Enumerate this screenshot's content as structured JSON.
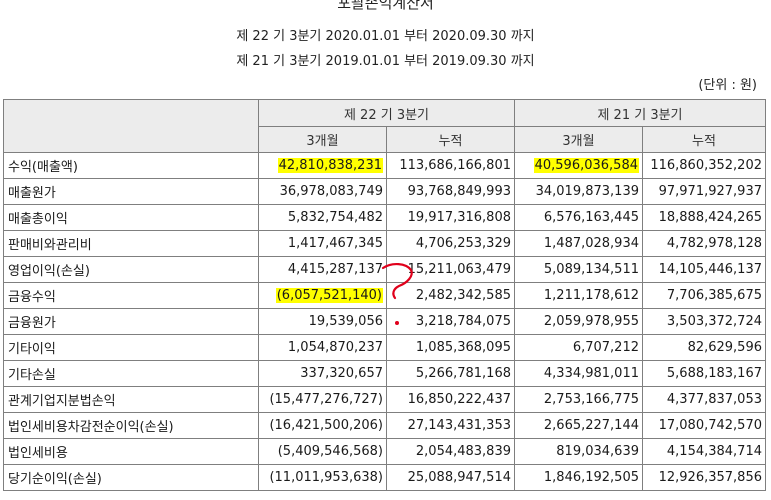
{
  "statement": {
    "title": "포괄손익계산서",
    "period_current": "제 22 기 3분기 2020.01.01 부터 2020.09.30 까지",
    "period_prior": "제 21 기 3분기 2019.01.01 부터 2019.09.30 까지",
    "unit": "(단위 : 원)"
  },
  "table": {
    "header": {
      "current_period": "제 22 기 3분기",
      "prior_period": "제 21 기 3분기",
      "three_month": "3개월",
      "cumulative": "누적"
    },
    "rows": [
      {
        "label": "수익(매출액)",
        "values": [
          "42,810,838,231",
          "113,686,166,801",
          "40,596,036,584",
          "116,860,352,202"
        ],
        "highlight": [
          true,
          false,
          true,
          false
        ]
      },
      {
        "label": "매출원가",
        "values": [
          "36,978,083,749",
          "93,768,849,993",
          "34,019,873,139",
          "97,971,927,937"
        ],
        "highlight": [
          false,
          false,
          false,
          false
        ]
      },
      {
        "label": "매출총이익",
        "values": [
          "5,832,754,482",
          "19,917,316,808",
          "6,576,163,445",
          "18,888,424,265"
        ],
        "highlight": [
          false,
          false,
          false,
          false
        ]
      },
      {
        "label": "판매비와관리비",
        "values": [
          "1,417,467,345",
          "4,706,253,329",
          "1,487,028,934",
          "4,782,978,128"
        ],
        "highlight": [
          false,
          false,
          false,
          false
        ]
      },
      {
        "label": "영업이익(손실)",
        "values": [
          "4,415,287,137",
          "15,211,063,479",
          "5,089,134,511",
          "14,105,446,137"
        ],
        "highlight": [
          false,
          false,
          false,
          false
        ]
      },
      {
        "label": "금융수익",
        "values": [
          "(6,057,521,140)",
          "2,482,342,585",
          "1,211,178,612",
          "7,706,385,675"
        ],
        "highlight": [
          true,
          false,
          false,
          false
        ]
      },
      {
        "label": "금융원가",
        "values": [
          "19,539,056",
          "3,218,784,075",
          "2,059,978,955",
          "3,503,372,724"
        ],
        "highlight": [
          false,
          false,
          false,
          false
        ]
      },
      {
        "label": "기타이익",
        "values": [
          "1,054,870,237",
          "1,085,368,095",
          "6,707,212",
          "82,629,596"
        ],
        "highlight": [
          false,
          false,
          false,
          false
        ]
      },
      {
        "label": "기타손실",
        "values": [
          "337,320,657",
          "5,266,781,168",
          "4,334,981,011",
          "5,688,183,167"
        ],
        "highlight": [
          false,
          false,
          false,
          false
        ]
      },
      {
        "label": "관계기업지분법손익",
        "values": [
          "(15,477,276,727)",
          "16,850,222,437",
          "2,753,166,775",
          "4,377,837,053"
        ],
        "highlight": [
          false,
          false,
          false,
          false
        ]
      },
      {
        "label": "법인세비용차감전순이익(손실)",
        "values": [
          "(16,421,500,206)",
          "27,143,431,353",
          "2,665,227,144",
          "17,080,742,570"
        ],
        "highlight": [
          false,
          false,
          false,
          false
        ]
      },
      {
        "label": "법인세비용",
        "values": [
          "(5,409,546,568)",
          "2,054,483,839",
          "819,034,639",
          "4,154,384,714"
        ],
        "highlight": [
          false,
          false,
          false,
          false
        ]
      },
      {
        "label": "당기순이익(손실)",
        "values": [
          "(11,011,953,638)",
          "25,088,947,514",
          "1,846,192,505",
          "12,926,357,856"
        ],
        "highlight": [
          false,
          false,
          false,
          false
        ]
      }
    ]
  },
  "colors": {
    "highlight": "#ffff00",
    "annotation_ink": "#e0001b",
    "header_bg": "#ececec",
    "border": "#7f7f7f"
  }
}
